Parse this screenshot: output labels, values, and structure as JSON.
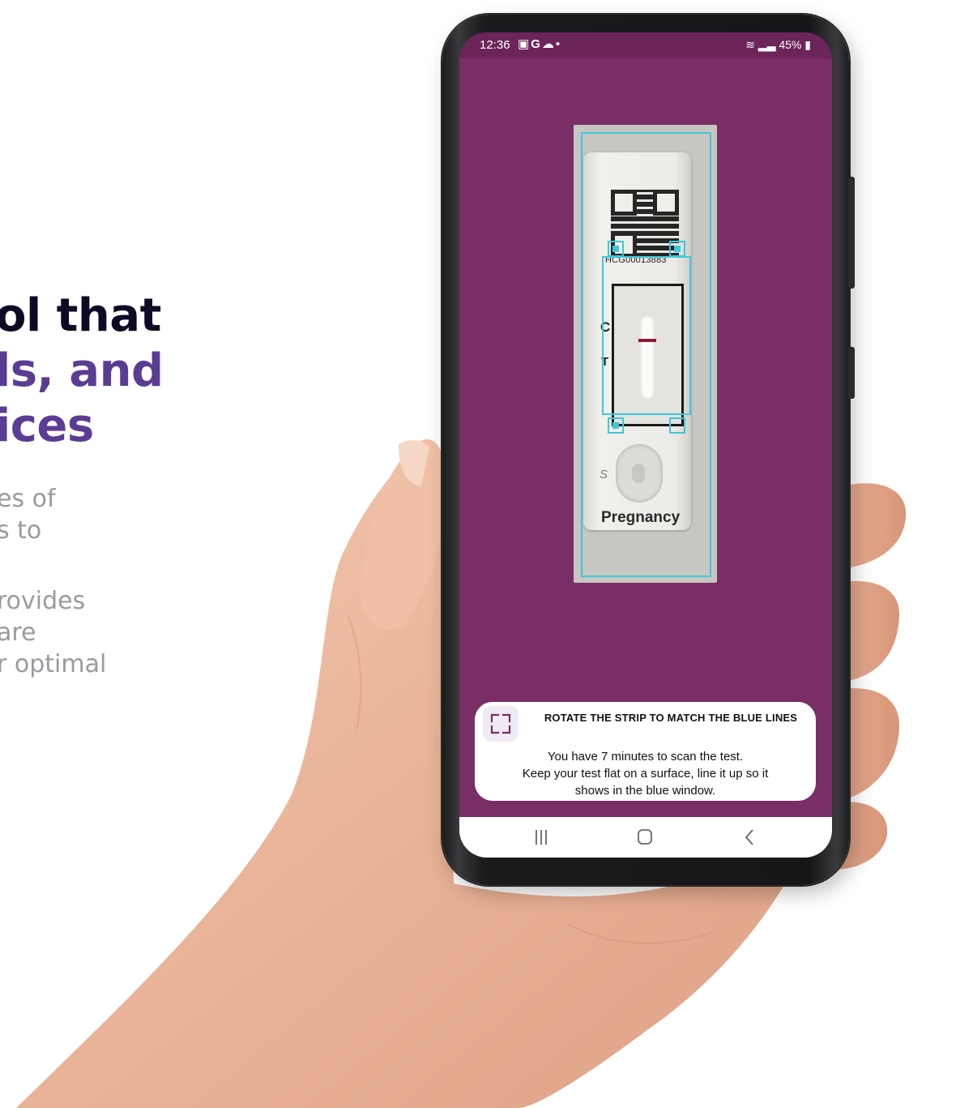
{
  "marketing": {
    "headline": [
      "ol that",
      "ls, and",
      "ices"
    ],
    "paragraph1": [
      "es of",
      "s to"
    ],
    "paragraph2": [
      "rovides",
      "are",
      "r optimal"
    ]
  },
  "status_bar": {
    "time": "12:36",
    "battery": "45%"
  },
  "test_strip": {
    "code": "HCG00013883",
    "label_c": "C",
    "label_t": "T",
    "label_s": "S",
    "brand": "Pregnancy"
  },
  "instruction": {
    "title": "ROTATE THE STRIP TO MATCH THE BLUE LINES",
    "body": [
      "You have 7 minutes to scan the test.",
      "Keep your test flat on a surface, line it up so it",
      "shows in the blue window."
    ]
  },
  "icons": {
    "scan": "scan-frame-icon",
    "nav_recent": "recent-apps-icon",
    "nav_home": "home-icon",
    "nav_back": "back-icon"
  },
  "colors": {
    "screen_bg": "#7a2e66",
    "guide": "#3fc7dc",
    "headline_dark": "#0e0a24",
    "headline_purple": "#5a3d93",
    "c_line": "#8c1b3e"
  }
}
